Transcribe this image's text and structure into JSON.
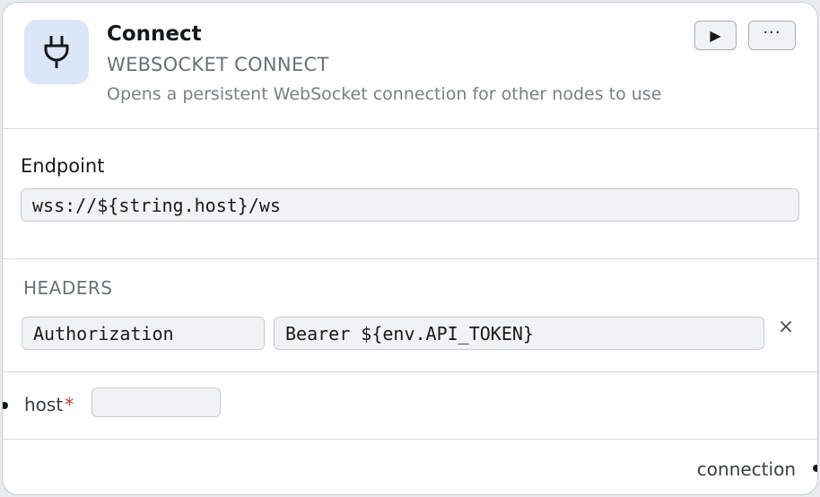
{
  "node": {
    "title": "Connect",
    "subtitle": "WEBSOCKET CONNECT",
    "description": "Opens a persistent WebSocket connection for other nodes to use",
    "icon": "plug-icon",
    "accent_color": "#dbe6f7"
  },
  "toolbar": {
    "run_label": "▶",
    "more_label": "···"
  },
  "endpoint": {
    "label": "Endpoint",
    "value": "wss://${string.host}/ws"
  },
  "headers": {
    "label": "HEADERS",
    "rows": [
      {
        "key": "Authorization",
        "value": "Bearer ${env.API_TOKEN}"
      }
    ],
    "remove_label": "×"
  },
  "inputs": [
    {
      "name": "host",
      "required_mark": "*",
      "value": ""
    }
  ],
  "outputs": [
    {
      "name": "connection"
    }
  ]
}
